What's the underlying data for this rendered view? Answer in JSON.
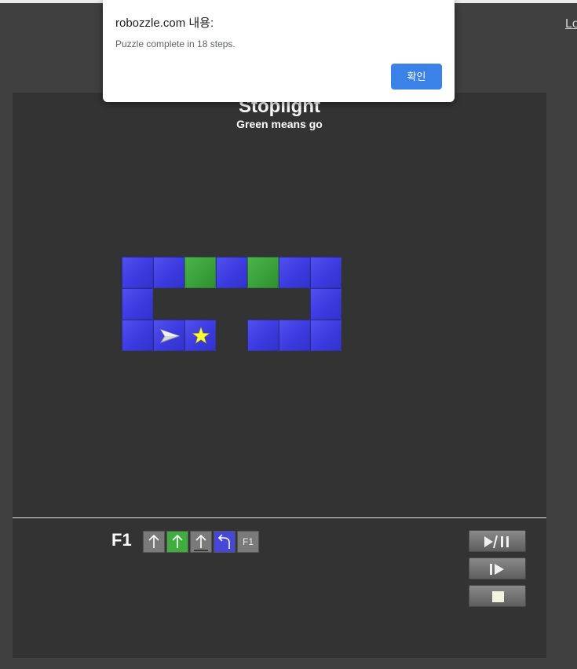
{
  "page": {
    "login_link": "Lo"
  },
  "puzzle": {
    "title": "Stoplight",
    "subtitle": "Green means go",
    "tile_colors": {
      "blue": "#3b3be0",
      "green": "#3aa23a"
    },
    "board": [
      {
        "row": 0,
        "col": 0,
        "color": "blue"
      },
      {
        "row": 0,
        "col": 1,
        "color": "blue"
      },
      {
        "row": 0,
        "col": 2,
        "color": "green"
      },
      {
        "row": 0,
        "col": 3,
        "color": "blue"
      },
      {
        "row": 0,
        "col": 4,
        "color": "green"
      },
      {
        "row": 0,
        "col": 5,
        "color": "blue"
      },
      {
        "row": 0,
        "col": 6,
        "color": "blue"
      },
      {
        "row": 1,
        "col": 0,
        "color": "blue"
      },
      {
        "row": 1,
        "col": 6,
        "color": "blue"
      },
      {
        "row": 2,
        "col": 0,
        "color": "blue"
      },
      {
        "row": 2,
        "col": 1,
        "color": "blue",
        "content": "robot-ship-icon",
        "facing": "right"
      },
      {
        "row": 2,
        "col": 2,
        "color": "blue",
        "content": "star-icon"
      },
      {
        "row": 2,
        "col": 4,
        "color": "blue"
      },
      {
        "row": 2,
        "col": 5,
        "color": "blue"
      },
      {
        "row": 2,
        "col": 6,
        "color": "blue"
      }
    ]
  },
  "program": {
    "function_label": "F1",
    "slots": [
      {
        "icon": "forward-arrow-icon",
        "color": "gray"
      },
      {
        "icon": "forward-arrow-icon",
        "color": "green"
      },
      {
        "icon": "forward-arrow-icon",
        "color": "gray",
        "active": true
      },
      {
        "icon": "turn-left-icon",
        "color": "blue"
      },
      {
        "text": "F1",
        "color": "gray"
      }
    ]
  },
  "controls": [
    {
      "name": "play-pause-button",
      "icon": "play-pause-icon"
    },
    {
      "name": "step-button",
      "icon": "step-icon"
    },
    {
      "name": "stop-button",
      "icon": "stop-icon"
    }
  ],
  "dialog": {
    "title": "robozzle.com 내용:",
    "message": "Puzzle complete in 18 steps.",
    "ok_label": "확인"
  }
}
